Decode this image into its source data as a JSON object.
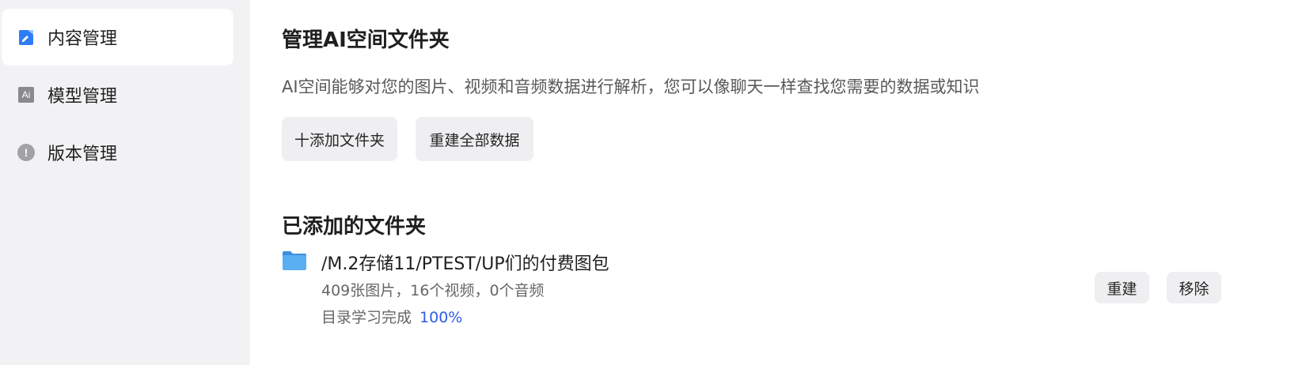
{
  "sidebar": {
    "items": [
      {
        "label": "内容管理",
        "icon": "document-edit-icon",
        "active": true
      },
      {
        "label": "模型管理",
        "icon": "ai-icon",
        "active": false
      },
      {
        "label": "版本管理",
        "icon": "info-icon",
        "active": false
      }
    ]
  },
  "main": {
    "title": "管理AI空间文件夹",
    "description": "AI空间能够对您的图片、视频和音频数据进行解析，您可以像聊天一样查找您需要的数据或知识",
    "add_folder_button": "十添加文件夹",
    "rebuild_all_button": "重建全部数据",
    "added_title": "已添加的文件夹",
    "folders": [
      {
        "path": "/M.2存储11/PTEST/UP们的付费图包",
        "stats": "409张图片，16个视频，0个音频",
        "progress_label": "目录学习完成",
        "progress_value": "100%",
        "rebuild_label": "重建",
        "remove_label": "移除"
      }
    ]
  },
  "colors": {
    "accent_blue": "#2f5bea",
    "folder_blue": "#4aa3f0",
    "sidebar_bg": "#f2f2f4",
    "button_bg": "#efeff1"
  }
}
